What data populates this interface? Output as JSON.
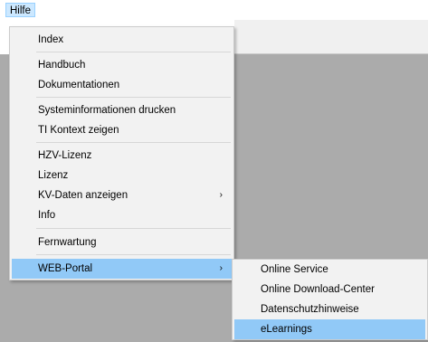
{
  "menubar": {
    "hilfe_label": "Hilfe"
  },
  "menu": {
    "items": [
      {
        "label": "Index"
      },
      {
        "label": "Handbuch"
      },
      {
        "label": "Dokumentationen"
      },
      {
        "label": "Systeminformationen drucken"
      },
      {
        "label": "TI Kontext zeigen"
      },
      {
        "label": "HZV-Lizenz"
      },
      {
        "label": "Lizenz"
      },
      {
        "label": "KV-Daten anzeigen",
        "submenu_arrow": "›"
      },
      {
        "label": "Info"
      },
      {
        "label": "Fernwartung"
      },
      {
        "label": "WEB-Portal",
        "submenu_arrow": "›",
        "selected": true
      }
    ]
  },
  "submenu": {
    "items": [
      {
        "label": "Online Service"
      },
      {
        "label": "Online Download-Center"
      },
      {
        "label": "Datenschutzhinweise"
      },
      {
        "label": "eLearnings",
        "selected": true
      }
    ]
  },
  "colors": {
    "menu_background": "#f2f2f2",
    "selection": "#91c9f7",
    "workspace": "#ababab",
    "menubar_highlight": "#cce8ff"
  }
}
